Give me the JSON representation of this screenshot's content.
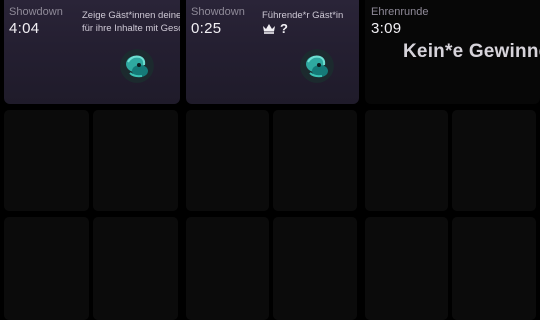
{
  "panels": [
    {
      "label": "Showdown",
      "timer": "4:04",
      "info_line1": "Zeige Gäst*innen deine Inhalte",
      "info_line2": "für ihre Inhalte mit Geschenken",
      "avatar_icon": "teal-character-avatar"
    },
    {
      "label": "Showdown",
      "timer": "0:25",
      "leader_title": "Führende*r Gäst*in",
      "leader_value": "?",
      "crown_icon": "crown-icon",
      "avatar_icon": "teal-character-avatar"
    },
    {
      "label": "Ehrenrunde",
      "timer": "3:09",
      "result_text": "Kein*e Gewinner*in"
    }
  ],
  "colors": {
    "background": "#000000",
    "active_panel": "#241f31",
    "tile": "#0b0b0b",
    "label": "#8f8a98",
    "timer": "#f1eff4"
  }
}
